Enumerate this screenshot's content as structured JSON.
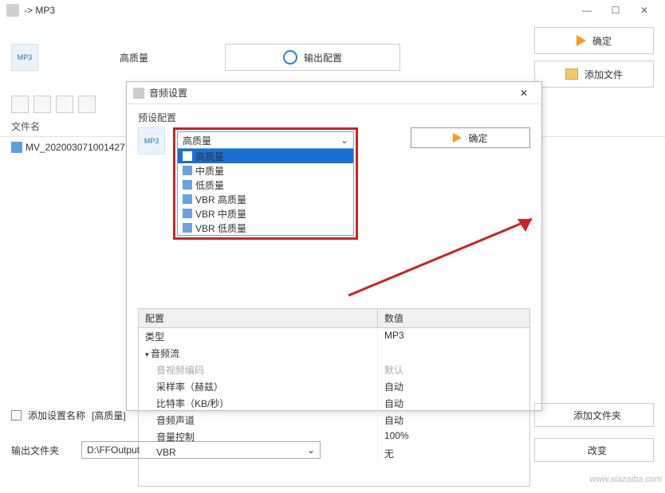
{
  "window": {
    "title": "-> MP3"
  },
  "header": {
    "quality_label": "高质量",
    "output_config_label": "输出配置",
    "ok_label": "确定",
    "add_file_label": "添加文件"
  },
  "file_header": "文件名",
  "files": [
    {
      "name": "MV_202003071001427"
    }
  ],
  "dialog": {
    "title": "音频设置",
    "preset_section": "预设配置",
    "combo_value": "高质量",
    "options": [
      {
        "label": "高质量",
        "selected": true
      },
      {
        "label": "中质量",
        "selected": false
      },
      {
        "label": "低质量",
        "selected": false
      },
      {
        "label": "VBR 高质量",
        "selected": false
      },
      {
        "label": "VBR 中质量",
        "selected": false
      },
      {
        "label": "VBR 低质量",
        "selected": false
      }
    ],
    "ok_label": "确定",
    "config_header": {
      "col1": "配置",
      "col2": "数值"
    },
    "rows": [
      {
        "k": "类型",
        "v": "MP3",
        "indent": 0,
        "group": false,
        "dim": false
      },
      {
        "k": "音频流",
        "v": "",
        "indent": 0,
        "group": true,
        "dim": false
      },
      {
        "k": "音视频编码",
        "v": "默认",
        "indent": 1,
        "group": false,
        "dim": true
      },
      {
        "k": "采样率（赫兹）",
        "v": "自动",
        "indent": 1,
        "group": false,
        "dim": false
      },
      {
        "k": "比特率（KB/秒）",
        "v": "自动",
        "indent": 1,
        "group": false,
        "dim": false
      },
      {
        "k": "音频声道",
        "v": "自动",
        "indent": 1,
        "group": false,
        "dim": false
      },
      {
        "k": "音量控制",
        "v": "100%",
        "indent": 1,
        "group": false,
        "dim": false
      },
      {
        "k": "VBR",
        "v": "无",
        "indent": 1,
        "group": false,
        "dim": false
      }
    ]
  },
  "bottom": {
    "add_settings_label": "添加设置名称",
    "settings_value": "[高质量]",
    "output_folder_label": "输出文件夹",
    "output_folder_value": "D:\\FFOutput",
    "add_folder_label": "添加文件夹",
    "change_label": "改变"
  },
  "watermark": "www.xiazaiba.com"
}
